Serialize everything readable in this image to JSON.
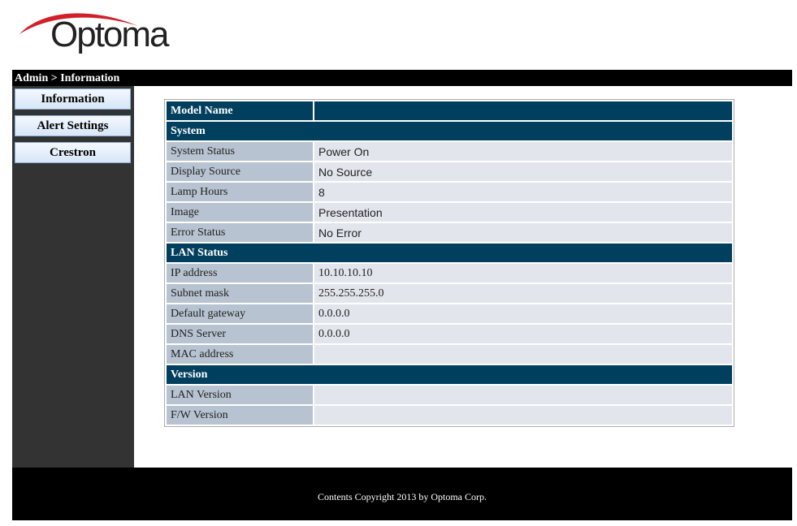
{
  "logo": {
    "text": "Optoma"
  },
  "header": {
    "breadcrumb": "Admin > Information"
  },
  "sidebar": {
    "items": [
      {
        "label": "Information"
      },
      {
        "label": "Alert Settings"
      },
      {
        "label": "Crestron"
      }
    ]
  },
  "info": {
    "model_name_label": "Model Name",
    "model_name_value": "",
    "system": {
      "title": "System",
      "rows": [
        {
          "label": "System Status",
          "value": "Power On"
        },
        {
          "label": "Display Source",
          "value": "No Source"
        },
        {
          "label": "Lamp Hours",
          "value": "8"
        },
        {
          "label": "Image",
          "value": "Presentation"
        },
        {
          "label": "Error Status",
          "value": "No Error"
        }
      ]
    },
    "lan": {
      "title": "LAN Status",
      "rows": [
        {
          "label": "IP address",
          "value": "10.10.10.10"
        },
        {
          "label": "Subnet mask",
          "value": "255.255.255.0"
        },
        {
          "label": "Default gateway",
          "value": "0.0.0.0"
        },
        {
          "label": "DNS Server",
          "value": "0.0.0.0"
        },
        {
          "label": "MAC address",
          "value": ""
        }
      ]
    },
    "version": {
      "title": "Version",
      "rows": [
        {
          "label": "LAN Version",
          "value": ""
        },
        {
          "label": "F/W Version",
          "value": ""
        }
      ]
    }
  },
  "footer": {
    "text": "Contents Copyright 2013 by Optoma Corp."
  }
}
